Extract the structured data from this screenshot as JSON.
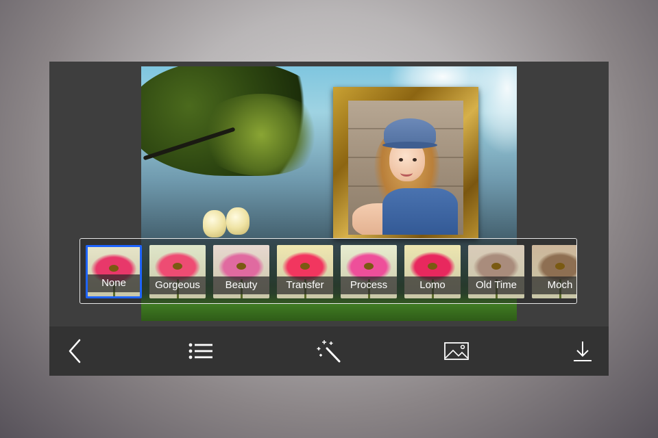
{
  "filters": [
    {
      "label": "None",
      "selected": true,
      "bg": "#e6e4c8",
      "petal": "#e8386a"
    },
    {
      "label": "Gorgeous",
      "selected": false,
      "bg": "#dfe6c9",
      "petal": "#ee4c73"
    },
    {
      "label": "Beauty",
      "selected": false,
      "bg": "#e8d8d0",
      "petal": "#e06aa0"
    },
    {
      "label": "Transfer",
      "selected": false,
      "bg": "#f0e7b0",
      "petal": "#f2365f"
    },
    {
      "label": "Process",
      "selected": false,
      "bg": "#e8edd0",
      "petal": "#ee4f9a"
    },
    {
      "label": "Lomo",
      "selected": false,
      "bg": "#ede6b0",
      "petal": "#e8285e"
    },
    {
      "label": "Old Time",
      "selected": false,
      "bg": "#d9cbb9",
      "petal": "#a98c7c"
    },
    {
      "label": "Moch",
      "selected": false,
      "bg": "#cdb69a",
      "petal": "#8e6f52"
    }
  ],
  "toolbar": {
    "icons": [
      "back-icon",
      "list-icon",
      "magic-wand-icon",
      "image-icon",
      "download-icon"
    ]
  },
  "colors": {
    "selected_border": "#1e64ff",
    "toolbar_bg": "#333333",
    "panel_bg": "#3e3e3e"
  }
}
